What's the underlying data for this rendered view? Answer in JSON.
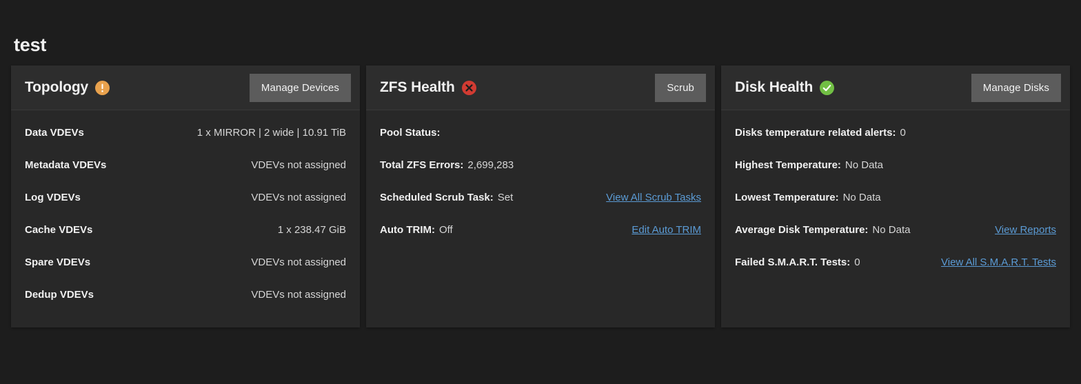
{
  "page": {
    "title": "test"
  },
  "cards": [
    {
      "id": "topology",
      "title": "Topology",
      "status_icon": "warning-icon",
      "status_kind": "warn",
      "action_label": "Manage Devices",
      "action_name": "manage-devices-button",
      "layout": "two-column",
      "rows": [
        {
          "label": "Data VDEVs",
          "value": "1 x MIRROR | 2 wide | 10.91 TiB",
          "link": ""
        },
        {
          "label": "Metadata VDEVs",
          "value": "VDEVs not assigned",
          "link": ""
        },
        {
          "label": "Log VDEVs",
          "value": "VDEVs not assigned",
          "link": ""
        },
        {
          "label": "Cache VDEVs",
          "value": "1 x 238.47 GiB",
          "link": ""
        },
        {
          "label": "Spare VDEVs",
          "value": "VDEVs not assigned",
          "link": ""
        },
        {
          "label": "Dedup VDEVs",
          "value": "VDEVs not assigned",
          "link": ""
        }
      ]
    },
    {
      "id": "zfs-health",
      "title": "ZFS Health",
      "status_icon": "error-icon",
      "status_kind": "error",
      "action_label": "Scrub",
      "action_name": "scrub-button",
      "layout": "inline",
      "rows": [
        {
          "label": "Pool Status:",
          "value": "",
          "link": ""
        },
        {
          "label": "Total ZFS Errors:",
          "value": "2,699,283",
          "link": ""
        },
        {
          "label": "Scheduled Scrub Task:",
          "value": "Set",
          "link": "View All Scrub Tasks"
        },
        {
          "label": "Auto TRIM:",
          "value": "Off",
          "link": "Edit Auto TRIM"
        }
      ]
    },
    {
      "id": "disk-health",
      "title": "Disk Health",
      "status_icon": "success-icon",
      "status_kind": "ok",
      "action_label": "Manage Disks",
      "action_name": "manage-disks-button",
      "layout": "inline",
      "rows": [
        {
          "label": "Disks temperature related alerts:",
          "value": "0",
          "link": ""
        },
        {
          "label": "Highest Temperature:",
          "value": "No Data",
          "link": ""
        },
        {
          "label": "Lowest Temperature:",
          "value": "No Data",
          "link": ""
        },
        {
          "label": "Average Disk Temperature:",
          "value": "No Data",
          "link": "View Reports"
        },
        {
          "label": "Failed S.M.A.R.T. Tests:",
          "value": "0",
          "link": "View All S.M.A.R.T. Tests"
        }
      ]
    }
  ],
  "colors": {
    "page_background": "#1d1d1d",
    "card_background": "#282828",
    "card_header_background": "#2d2d2d",
    "button_background": "#5c5c5c",
    "link": "#5b9bd5",
    "status_warning": "#e8a14d",
    "status_error": "#d13b32",
    "status_ok": "#71bf44",
    "text_primary": "#f0f0f0",
    "text_secondary": "#d6d6d6"
  }
}
